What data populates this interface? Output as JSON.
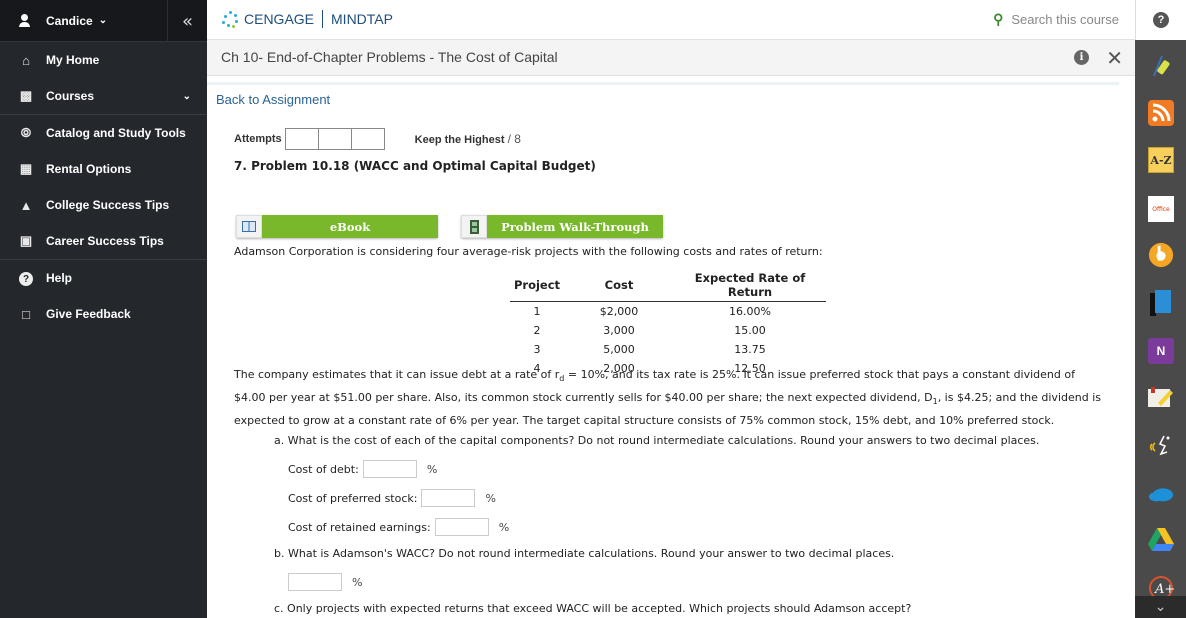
{
  "sidebar": {
    "user_name": "Candice",
    "collapse_icon": "double-chevron-left",
    "items": [
      {
        "label": "My Home",
        "icon": "home-icon"
      },
      {
        "label": "Courses",
        "icon": "book-icon"
      },
      {
        "label": "Catalog and Study Tools",
        "icon": "compass-icon"
      },
      {
        "label": "Rental Options",
        "icon": "open-book-icon"
      },
      {
        "label": "College Success Tips",
        "icon": "graduation-cap-icon"
      },
      {
        "label": "Career Success Tips",
        "icon": "briefcase-icon"
      },
      {
        "label": "Help",
        "icon": "question-circle-icon"
      },
      {
        "label": "Give Feedback",
        "icon": "feedback-icon"
      }
    ]
  },
  "header": {
    "brand": "CENGAGE",
    "product": "MINDTAP",
    "search_placeholder": "Search this course",
    "help_glyph": "?"
  },
  "titlebar": {
    "title": "Ch 10- End-of-Chapter Problems - The Cost of Capital",
    "info_glyph": "i",
    "close_glyph": "✕"
  },
  "rail": {
    "tools": [
      "highlighter-icon",
      "rss-icon",
      "a-z-glossary-icon",
      "office-icon",
      "flashcards-icon",
      "book-icon",
      "onenote-icon",
      "notes-icon",
      "readspeaker-icon",
      "onedrive-icon",
      "google-drive-icon",
      "aplus-icon"
    ],
    "az_label": "A-Z",
    "office_label": "Office",
    "onenote_label": "N"
  },
  "content": {
    "back_link": "Back to Assignment",
    "attempts_label": "Attempts",
    "keep_label": "Keep the Highest",
    "keep_value": "/ 8",
    "problem_title": "7.  Problem 10.18 (WACC and Optimal Capital Budget)",
    "ebook_label": "eBook",
    "walkthrough_label": "Problem Walk-Through",
    "intro": "Adamson Corporation is considering four average-risk projects with the following costs and rates of return:",
    "table": {
      "headers": [
        "Project",
        "Cost",
        "Expected Rate of Return"
      ],
      "rows": [
        [
          "1",
          "$2,000",
          "16.00%"
        ],
        [
          "2",
          "3,000",
          "15.00"
        ],
        [
          "3",
          "5,000",
          "13.75"
        ],
        [
          "4",
          "2,000",
          "12.50"
        ]
      ]
    },
    "body_line1_a": "The company estimates that it can issue debt at a rate of r",
    "body_line1_sub": "d",
    "body_line1_b": " = 10%, and its tax rate is 25%. It can issue preferred stock that pays a constant dividend of",
    "body_line2_a": "$4.00 per year at $51.00 per share. Also, its common stock currently sells for $40.00 per share; the next expected dividend, D",
    "body_line2_sub": "1",
    "body_line2_b": ", is $4.25; and the dividend is",
    "body_line3": "expected to grow at a constant rate of 6% per year. The target capital structure consists of 75% common stock, 15% debt, and 10% preferred stock.",
    "question_a": "a. What is the cost of each of the capital components? Do not round intermediate calculations. Round your answers to two decimal places.",
    "fields": [
      {
        "label": "Cost of debt:",
        "value": "",
        "unit": "%"
      },
      {
        "label": "Cost of preferred stock:",
        "value": "",
        "unit": "%"
      },
      {
        "label": "Cost of retained earnings:",
        "value": "",
        "unit": "%"
      }
    ],
    "question_b": "b. What is Adamson's WACC? Do not round intermediate calculations. Round your answer to two decimal places.",
    "wacc_value": "",
    "wacc_unit": "%",
    "question_c": "c. Only projects with expected returns that exceed WACC will be accepted. Which projects should Adamson accept?"
  }
}
